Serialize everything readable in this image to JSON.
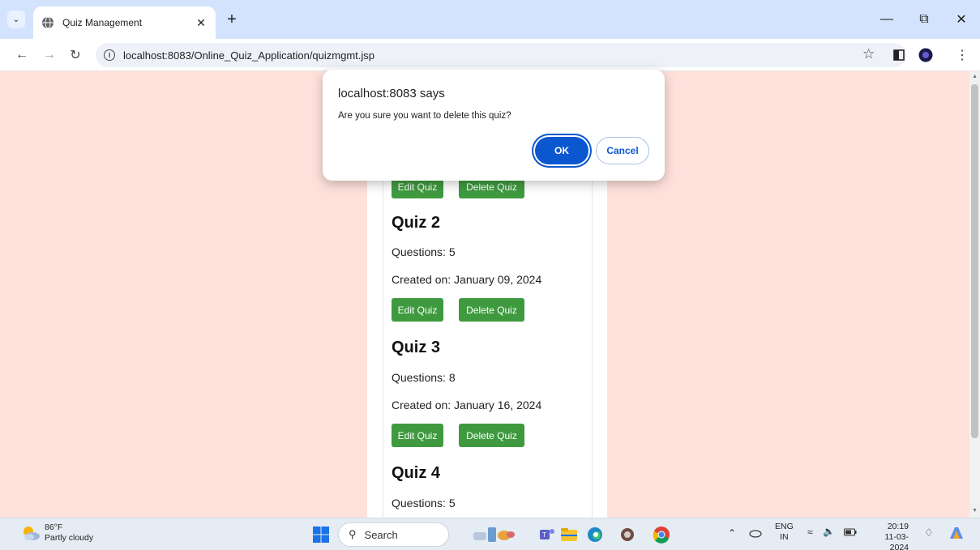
{
  "browser": {
    "tab_title": "Quiz Management",
    "url": "localhost:8083/Online_Quiz_Application/quizmgmt.jsp"
  },
  "quizzes": [
    {
      "title": "Quiz 2",
      "questions": "Questions: 5",
      "created": "Created on: January 09, 2024",
      "edit_label": "Edit Quiz",
      "delete_label": "Delete Quiz"
    },
    {
      "title": "Quiz 3",
      "questions": "Questions: 8",
      "created": "Created on: January 16, 2024",
      "edit_label": "Edit Quiz",
      "delete_label": "Delete Quiz"
    },
    {
      "title": "Quiz 4",
      "questions": "Questions: 5"
    }
  ],
  "partial_buttons": {
    "edit_label": "Edit Quiz",
    "delete_label": "Delete Quiz"
  },
  "dialog": {
    "title": "localhost:8083 says",
    "message": "Are you sure you want to delete this quiz?",
    "ok_label": "OK",
    "cancel_label": "Cancel"
  },
  "taskbar": {
    "temperature": "86°F",
    "weather": "Partly cloudy",
    "search_label": "Search",
    "lang_top": "ENG",
    "lang_bottom": "IN",
    "time": "20:19",
    "date": "11-03-2024"
  },
  "colors": {
    "page_bg": "#ffe1dc",
    "button_green": "#3f9a3f",
    "dialog_accent": "#0b57d0"
  }
}
